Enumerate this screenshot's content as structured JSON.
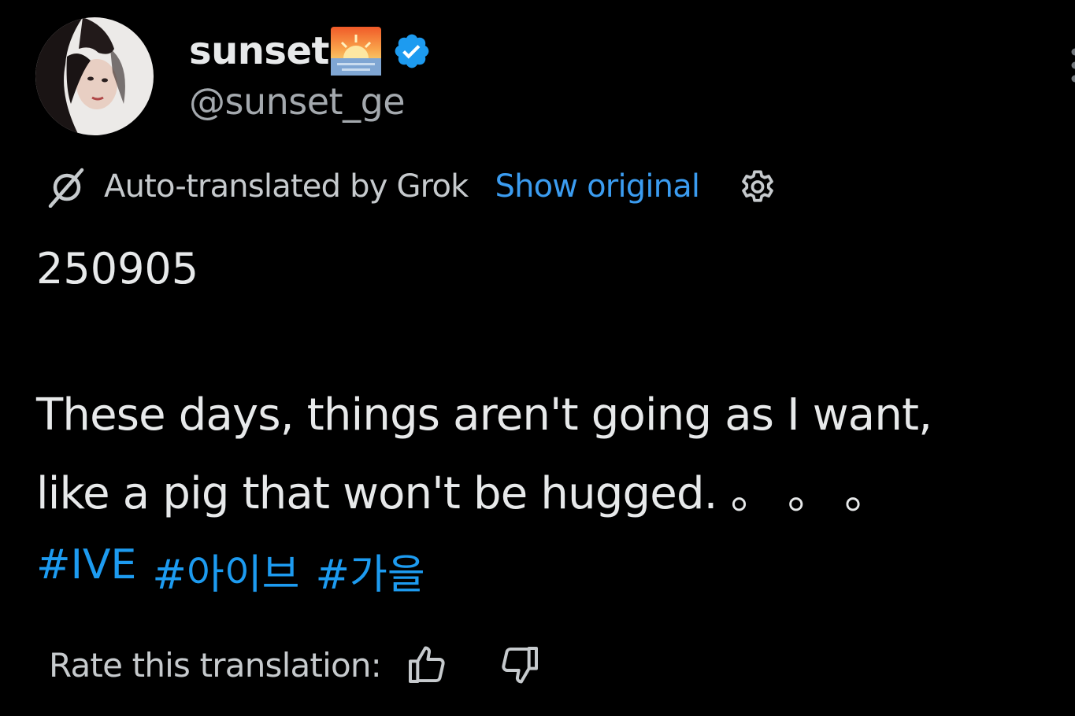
{
  "header": {
    "display_name": "sunset",
    "display_name_emoji": "sunrise-emoji-icon",
    "verified": true,
    "verified_color": "#1d9bf0",
    "handle": "@sunset_ge"
  },
  "translation_bar": {
    "icon": "grok-icon",
    "label": "Auto-translated by Grok",
    "show_original_label": "Show original",
    "link_color": "#3b9cf0",
    "settings_icon": "gear-icon"
  },
  "post": {
    "date_line": "250905",
    "body_line_1": "These days, things aren't going as I want,",
    "body_line_2": "like a pig that won't be hugged. 。 。 。",
    "hashtags": [
      "#IVE",
      "#아이브",
      "#가을"
    ],
    "hashtag_color": "#1d9bf0"
  },
  "rating": {
    "label": "Rate this translation:",
    "thumbs_up_icon": "thumbs-up-icon",
    "thumbs_down_icon": "thumbs-down-icon"
  },
  "theme": {
    "background": "#000000",
    "text": "#e7e9ea",
    "secondary_text": "#a4a9ae"
  }
}
